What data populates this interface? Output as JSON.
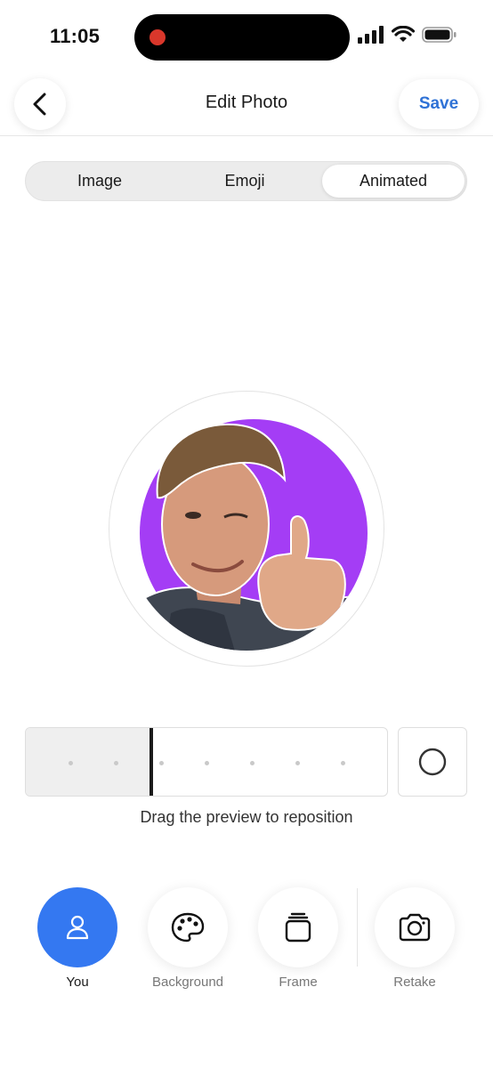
{
  "status_bar": {
    "time": "11:05",
    "icons": [
      "cellular-signal-icon",
      "wifi-icon",
      "battery-icon"
    ],
    "recording_indicator_color": "#d9372b"
  },
  "header": {
    "title": "Edit Photo",
    "save_label": "Save",
    "back_icon": "chevron-left-icon",
    "accent_color": "#2f72d6"
  },
  "tabs": {
    "items": [
      "Image",
      "Emoji",
      "Animated"
    ],
    "selected": "Animated"
  },
  "preview": {
    "background_color": "#a43df5"
  },
  "timeline": {
    "record_icon": "record-circle-icon"
  },
  "hint": "Drag the preview to reposition",
  "tools": {
    "items": [
      {
        "label": "You",
        "icon": "person-icon",
        "active": true
      },
      {
        "label": "Background",
        "icon": "palette-icon",
        "active": false
      },
      {
        "label": "Frame",
        "icon": "frame-stack-icon",
        "active": false
      },
      {
        "label": "Retake",
        "icon": "camera-icon",
        "active": false
      }
    ],
    "active_color": "#3478f1"
  }
}
